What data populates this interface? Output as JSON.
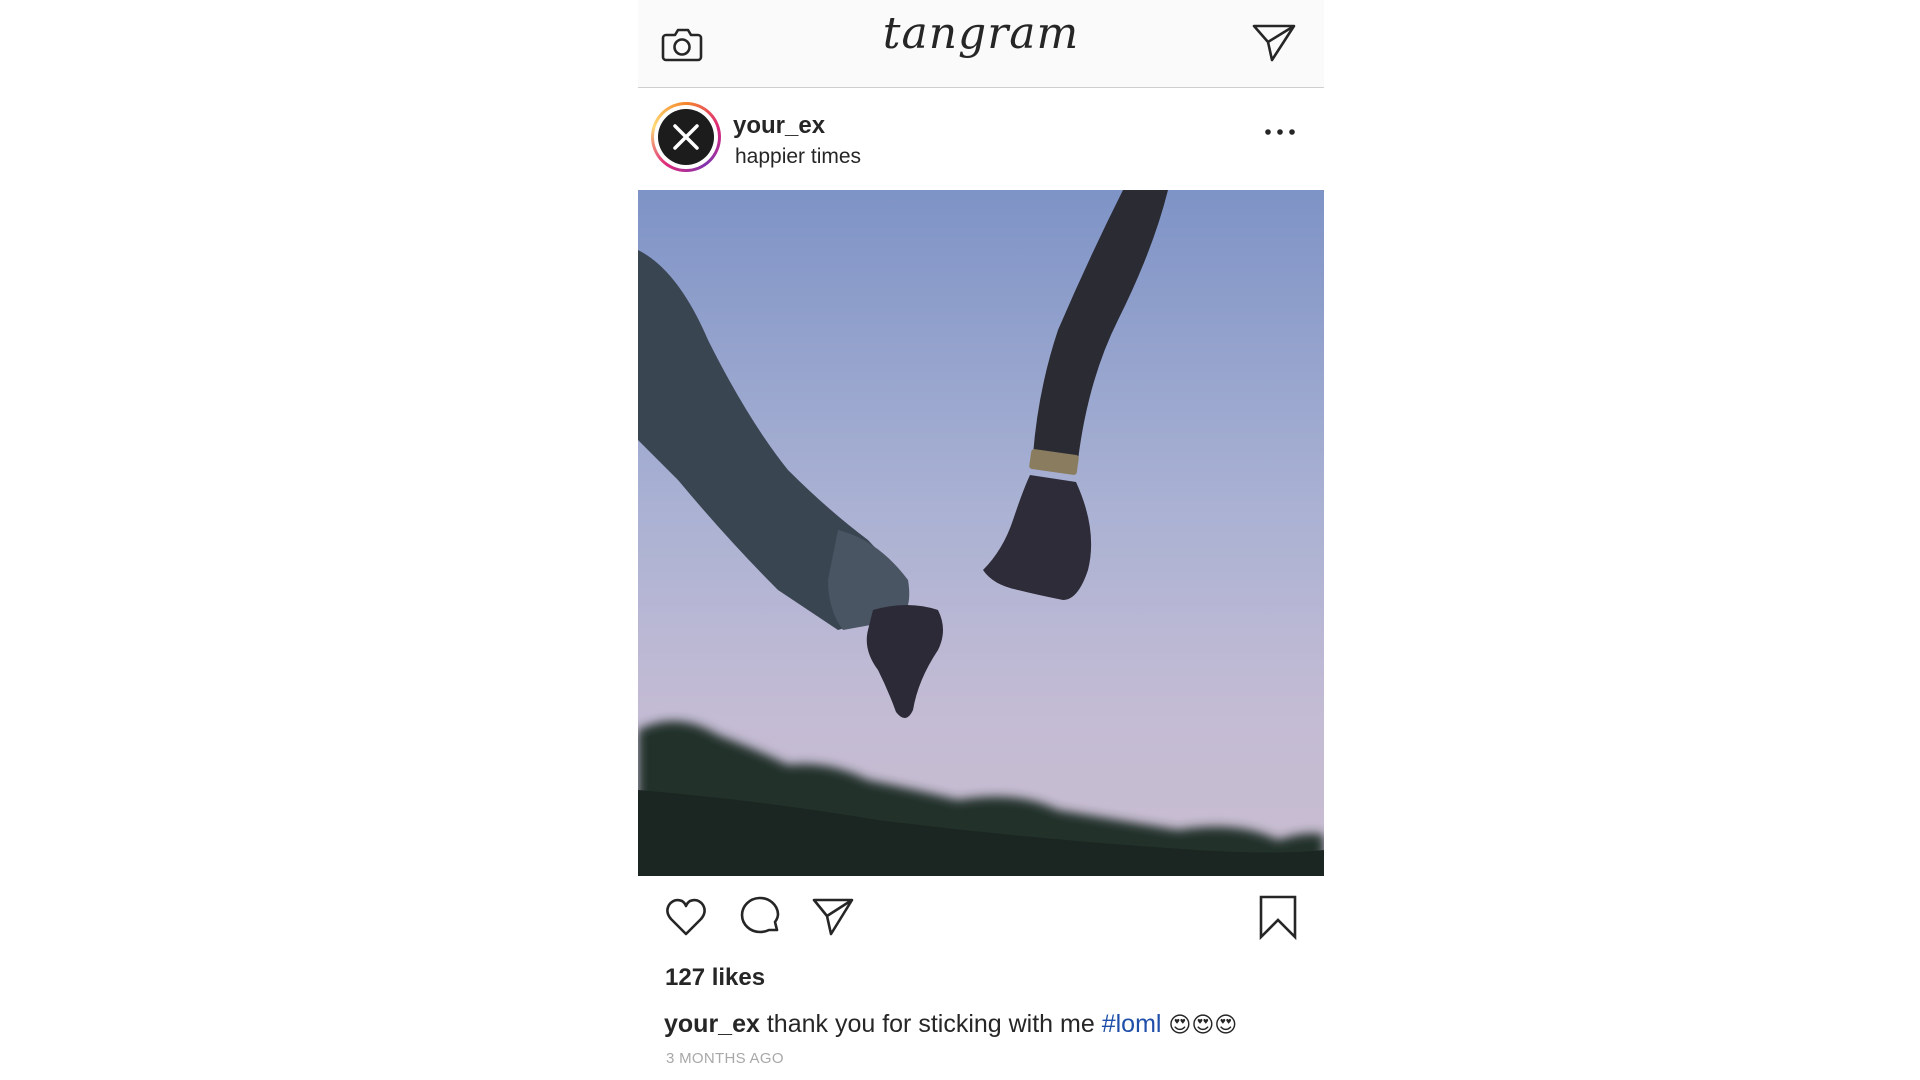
{
  "app": {
    "logo_text": "tangram"
  },
  "icons": {
    "camera": "camera-icon",
    "direct": "direct-message-icon",
    "more": "more-options-icon",
    "like": "heart-icon",
    "comment": "comment-icon",
    "share": "share-icon",
    "save": "bookmark-icon",
    "avatar": "close-x-icon"
  },
  "post": {
    "username": "your_ex",
    "location": "happier times",
    "likes": "127 likes",
    "caption": {
      "username": "your_ex",
      "text": "thank you for sticking with me",
      "hashtag": "#loml",
      "emoji": "😍😍😍"
    },
    "timestamp": "3 MONTHS AGO"
  },
  "colors": {
    "hashtag": "#1f4fa8",
    "text": "#262626",
    "timestamp": "#a8a8a8"
  }
}
